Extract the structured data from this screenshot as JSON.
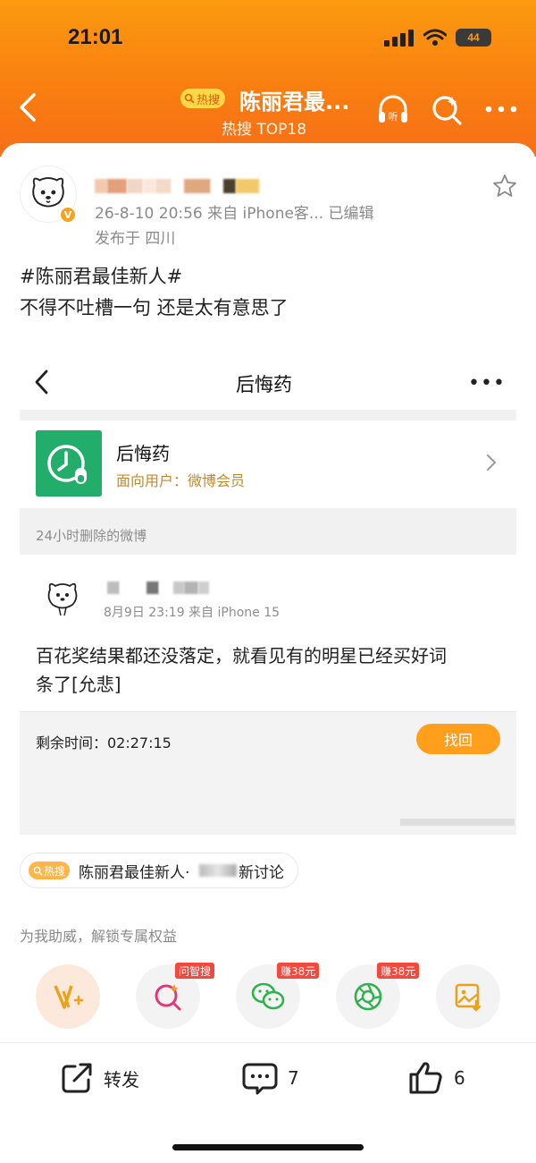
{
  "status_bar": {
    "time": "21:01",
    "battery": "44"
  },
  "header": {
    "hot_badge": "热搜",
    "title": "陈丽君最...",
    "subtitle": "热搜 TOP18",
    "listen_label": "听"
  },
  "post": {
    "meta_line1": "26-8-10 20:56  来自 iPhone客...  已编辑",
    "meta_line2": "发布于 四川",
    "hashtag": "#陈丽君最佳新人#",
    "text": "不得不吐槽一句 还是太有意思了"
  },
  "embedded": {
    "page_title": "后悔药",
    "more": "•••",
    "app_name": "后悔药",
    "app_desc": "面向用户：微博会员",
    "section_label": "24小时删除的微博",
    "inner_meta": "8月9日 23:19  来自 iPhone 15",
    "inner_text_line1": "百花奖结果都还没落定，就看见有的明星已经买好词",
    "inner_text_line2": "条了[允悲]",
    "remaining_label": "剩余时间：02:27:15",
    "recover_button": "找回"
  },
  "topic": {
    "badge": "热搜",
    "text": "陈丽君最佳新人·",
    "suffix": "新讨论"
  },
  "support": {
    "text": "为我助威，解锁专属权益",
    "badges": [
      "问智搜",
      "赚38元",
      "赚38元"
    ]
  },
  "actions": {
    "repost": "转发",
    "comments": "7",
    "likes": "6"
  },
  "colors": {
    "header_orange": "#f97f10",
    "accent_orange": "#ff9f1c",
    "app_icon_green": "#22ad6a",
    "badge_red": "#f2483d"
  }
}
